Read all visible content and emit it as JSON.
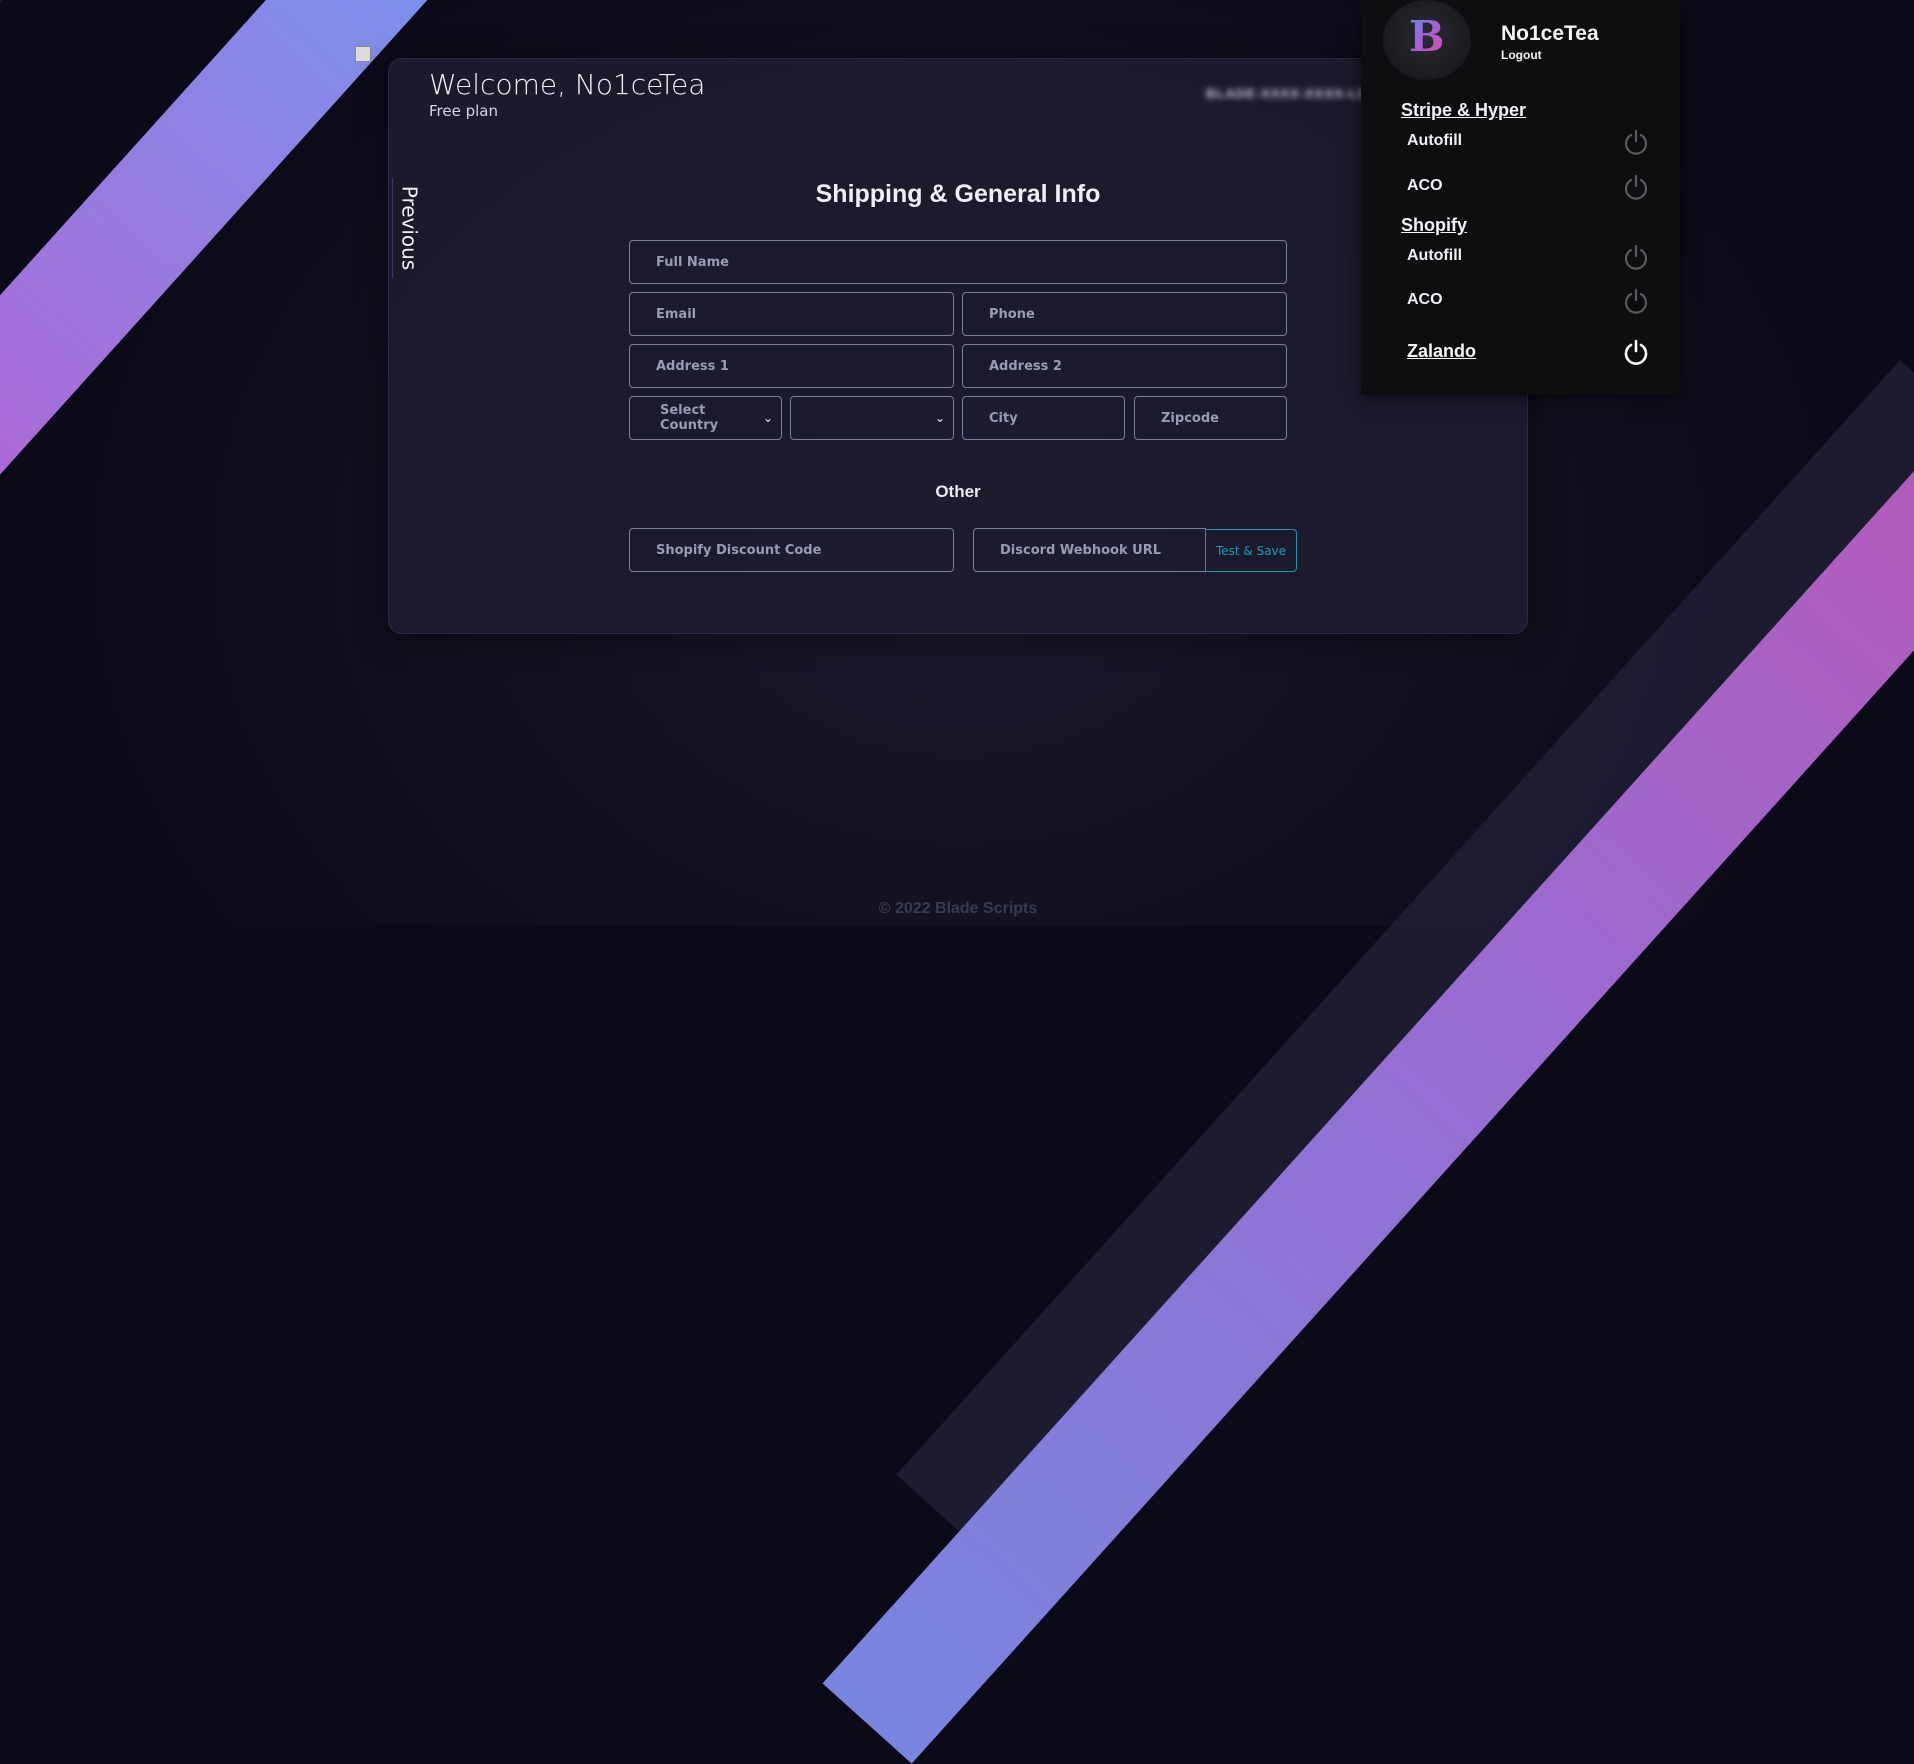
{
  "header": {
    "welcome": "Welcome, No1ceTea",
    "plan": "Free plan",
    "license_key": "BLADE-XXXX-XXXX-LEE"
  },
  "nav": {
    "previous_label": "Previous"
  },
  "form": {
    "title": "Shipping & General Info",
    "full_name_placeholder": "Full Name",
    "email_placeholder": "Email",
    "phone_placeholder": "Phone",
    "address1_placeholder": "Address 1",
    "address2_placeholder": "Address 2",
    "country_selected": "Select Country",
    "state_selected": "",
    "city_placeholder": "City",
    "zipcode_placeholder": "Zipcode"
  },
  "other": {
    "title": "Other",
    "discount_placeholder": "Shopify Discount Code",
    "webhook_placeholder": "Discord Webhook URL",
    "test_save_label": "Test & Save"
  },
  "footer": {
    "copyright": "© 2022 Blade Scripts"
  },
  "user_panel": {
    "username": "No1ceTea",
    "logout_label": "Logout",
    "sections": [
      {
        "title": "Stripe & Hyper",
        "items": [
          {
            "label": "Autofill"
          },
          {
            "label": "ACO"
          }
        ]
      },
      {
        "title": "Shopify",
        "items": [
          {
            "label": "Autofill"
          },
          {
            "label": "ACO"
          }
        ]
      },
      {
        "title": "Zalando"
      }
    ]
  },
  "colors": {
    "accent_teal": "#1f9bb9",
    "stripe_blue": "#6a9ef2",
    "stripe_pink": "#d04a9f",
    "power_active": "#ffffff",
    "power_inactive": "#5a5a5e"
  },
  "icons": {
    "power": "power-icon",
    "chevron": "chevron-down-icon",
    "logo": "blade-logo-icon"
  }
}
